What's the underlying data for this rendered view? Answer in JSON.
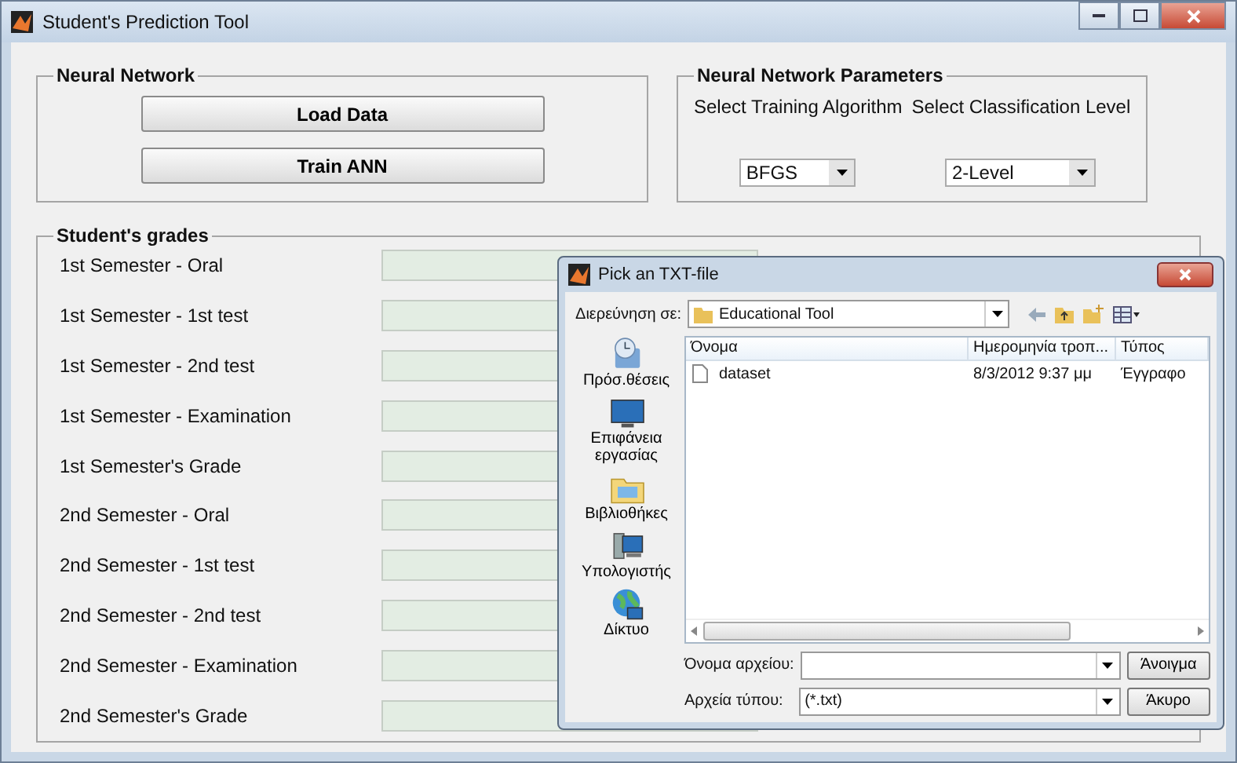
{
  "window": {
    "title": "Student's Prediction Tool"
  },
  "neural_network": {
    "title": "Neural Network",
    "buttons": [
      "Load Data",
      "Train ANN"
    ]
  },
  "parameters": {
    "title": "Neural Network Parameters",
    "selectors": [
      {
        "label": "Select Training Algorithm",
        "value": "BFGS"
      },
      {
        "label": "Select Classification Level",
        "value": "2-Level"
      }
    ]
  },
  "grades": {
    "title": "Student's grades",
    "rows": [
      {
        "label": "1st Semester - Oral"
      },
      {
        "label": "1st Semester - 1st test"
      },
      {
        "label": "1st Semester - 2nd test"
      },
      {
        "label": "1st Semester - Examination"
      },
      {
        "label": "1st Semester's Grade"
      },
      {
        "label": "2nd Semester - Oral"
      },
      {
        "label": "2nd Semester - 1st test"
      },
      {
        "label": "2nd Semester - 2nd test"
      },
      {
        "label": "2nd Semester - Examination"
      },
      {
        "label": "2nd Semester's Grade"
      }
    ]
  },
  "dialog": {
    "title": "Pick an TXT-file",
    "look_in_label": "Διερεύνηση σε:",
    "look_in_value": "Educational Tool",
    "places": [
      {
        "label": "Πρόσ.θέσεις"
      },
      {
        "label": "Επιφάνεια εργασίας"
      },
      {
        "label": "Βιβλιοθήκες"
      },
      {
        "label": "Υπολογιστής"
      },
      {
        "label": "Δίκτυο"
      }
    ],
    "columns": [
      "Όνομα",
      "Ημερομηνία τροπ...",
      "Τύπος"
    ],
    "files": [
      {
        "name": "dataset",
        "modified": "8/3/2012 9:37 μμ",
        "type": "Έγγραφο"
      }
    ],
    "file_name_label": "Όνομα αρχείου:",
    "file_type_label": "Αρχεία τύπου:",
    "file_type_value": "(*.txt)",
    "buttons": [
      "Άνοιγμα",
      "Άκυρο"
    ]
  }
}
